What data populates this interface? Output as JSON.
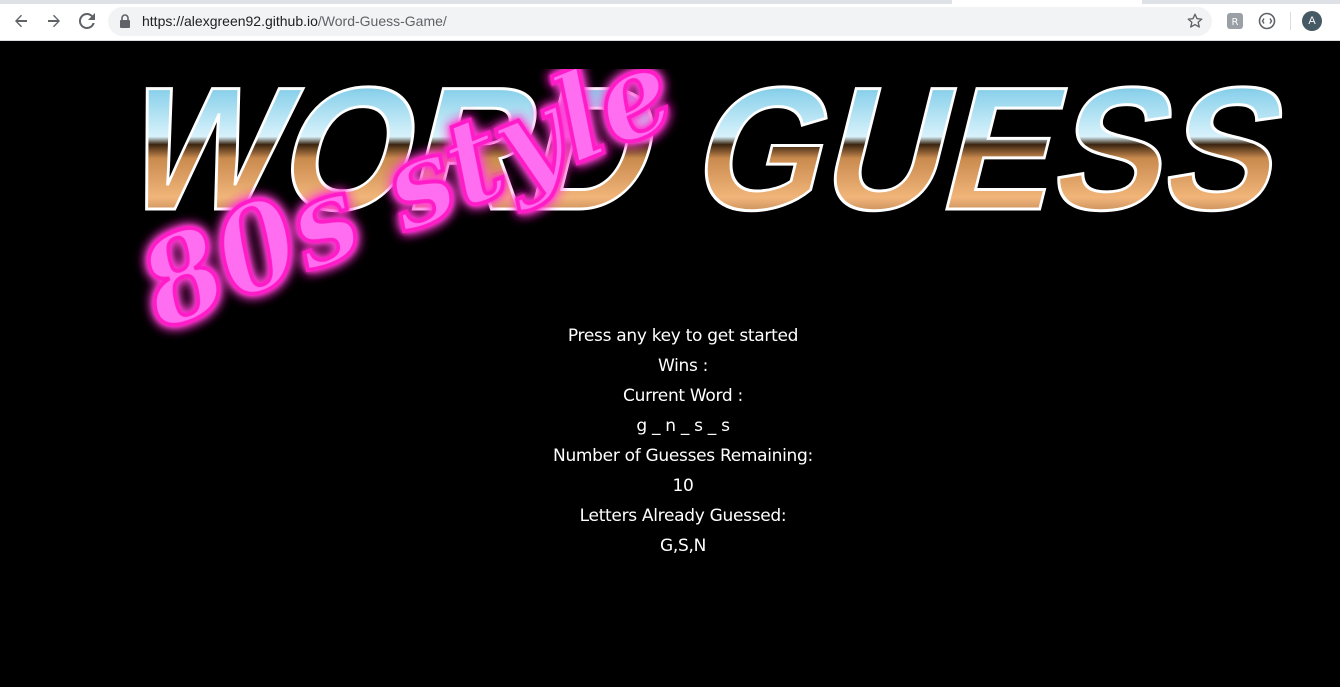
{
  "browser": {
    "url_host": "https://alexgreen92.github.io",
    "url_path": "/Word-Guess-Game/",
    "profile_initial": "A",
    "icons": [
      "back-arrow-icon",
      "forward-arrow-icon",
      "reload-icon",
      "lock-icon",
      "star-icon",
      "extension-icon",
      "extension-icon",
      "avatar"
    ]
  },
  "logo": {
    "main_text": "WORD GUESS",
    "neon_text": "80s style",
    "colors": {
      "chrome_top": "#5fb8e0",
      "chrome_bottom": "#8a4a1e",
      "neon": "#ff4fe0"
    }
  },
  "game": {
    "prompt": "Press any key to get started",
    "wins_label": "Wins :",
    "current_word_label": "Current Word :",
    "current_word": "g _ n _ s _ s",
    "guesses_remaining_label": "Number of Guesses Remaining:",
    "guesses_remaining": "10",
    "letters_guessed_label": "Letters Already Guessed:",
    "letters_guessed": "G,S,N"
  }
}
